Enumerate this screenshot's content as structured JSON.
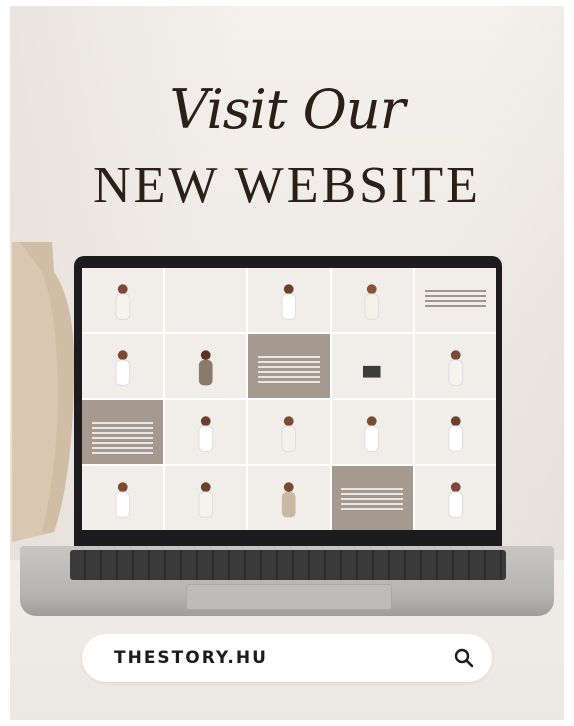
{
  "headline": {
    "script_line": "Visit Our",
    "main_line": "NEW WEBSITE"
  },
  "search_bar": {
    "text": "THESTORY.HU",
    "icon": "search-icon"
  },
  "colors": {
    "text_dark": "#2a2018",
    "tile_taupe": "#a6998f",
    "laptop_bezel": "#1c1c1e",
    "search_bg": "#ffffff"
  }
}
